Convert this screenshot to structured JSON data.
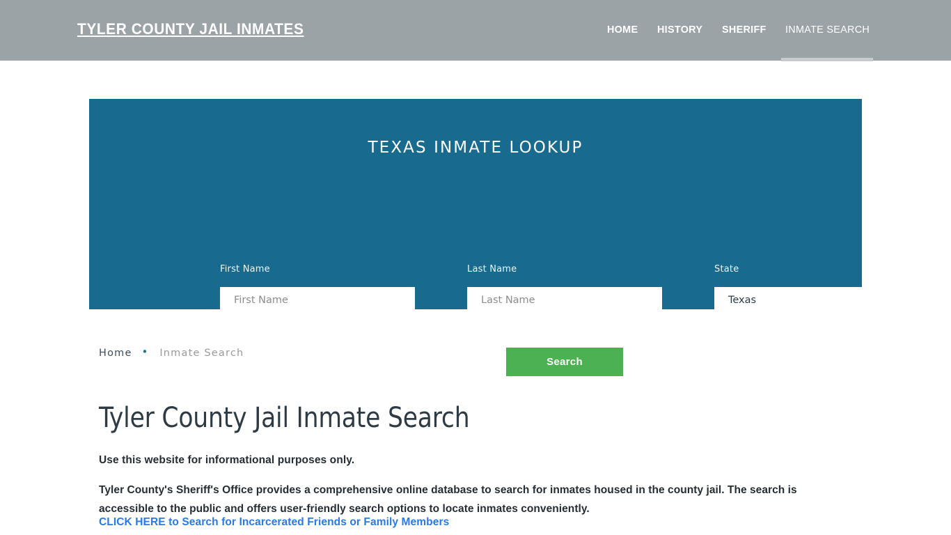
{
  "header": {
    "brand": "Tyler County Jail Inmates",
    "nav": [
      {
        "label": "Home",
        "active": false
      },
      {
        "label": "History",
        "active": false
      },
      {
        "label": "Sheriff",
        "active": false
      },
      {
        "label": "Inmate Search",
        "active": true
      }
    ],
    "background_color": "#9ca3a7",
    "active_indicator_color": "#c7cbce"
  },
  "lookup": {
    "title": "Texas Inmate Lookup",
    "panel_color": "#186a8e",
    "fields": {
      "first_name": {
        "label": "First Name",
        "placeholder": "First Name",
        "value": ""
      },
      "last_name": {
        "label": "Last Name",
        "placeholder": "Last Name",
        "value": ""
      },
      "state": {
        "label": "State",
        "placeholder": "State",
        "value": "Texas"
      }
    },
    "search_button": {
      "label": "Search",
      "color": "#4cb152"
    }
  },
  "breadcrumb": {
    "home": "Home",
    "separator": "•",
    "current": "Inmate Search",
    "separator_color": "#1d7296"
  },
  "main": {
    "title": "Tyler County Jail Inmate Search",
    "lead": "Use this website for informational purposes only.",
    "paragraph": "Tyler County's Sheriff's Office provides a comprehensive online database to search for inmates housed in the county jail. The search is accessible to the public and offers user-friendly search options to locate inmates conveniently.",
    "cta_link": "CLICK HERE to Search for Incarcerated Friends or Family Members",
    "cta_link_color": "#2979e8"
  }
}
